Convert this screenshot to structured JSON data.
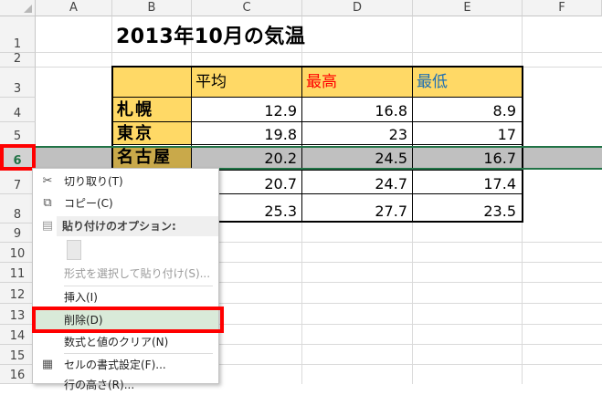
{
  "columns": [
    "A",
    "B",
    "C",
    "D",
    "E",
    "F"
  ],
  "rows": [
    "1",
    "2",
    "3",
    "4",
    "5",
    "6",
    "7",
    "8",
    "9",
    "10",
    "11",
    "12",
    "13",
    "14",
    "15",
    "16"
  ],
  "title": "2013年10月の気温",
  "table": {
    "headers": [
      "平均",
      "最高",
      "最低"
    ],
    "header_colors": [
      "#000000",
      "#ff0000",
      "#1f6fb4"
    ],
    "rows": [
      {
        "city": "札幌",
        "avg": "12.9",
        "max": "16.8",
        "min": "8.9"
      },
      {
        "city": "東京",
        "avg": "19.8",
        "max": "23",
        "min": "17"
      },
      {
        "city": "名古屋",
        "avg": "20.2",
        "max": "24.5",
        "min": "16.7"
      },
      {
        "city": "",
        "avg": "20.7",
        "max": "24.7",
        "min": "17.4"
      },
      {
        "city": "",
        "avg": "25.3",
        "max": "27.7",
        "min": "23.5"
      }
    ]
  },
  "context_menu": {
    "cut": "切り取り(T)",
    "copy": "コピー(C)",
    "paste_options_header": "貼り付けのオプション:",
    "paste_special": "形式を選択して貼り付け(S)...",
    "insert": "挿入(I)",
    "delete": "削除(D)",
    "clear_contents": "数式と値のクリア(N)",
    "format_cells": "セルの書式設定(F)...",
    "row_height": "行の高さ(R)..."
  },
  "colors": {
    "header_fill": "#ffd966",
    "selected_row_fill": "#c0c0c0",
    "highlight_red": "#ff0000",
    "selection_green": "#217346"
  },
  "icons": {
    "cut": "scissors-icon",
    "copy": "copy-icon",
    "paste": "clipboard-icon",
    "format_cells": "format-cells-icon"
  }
}
